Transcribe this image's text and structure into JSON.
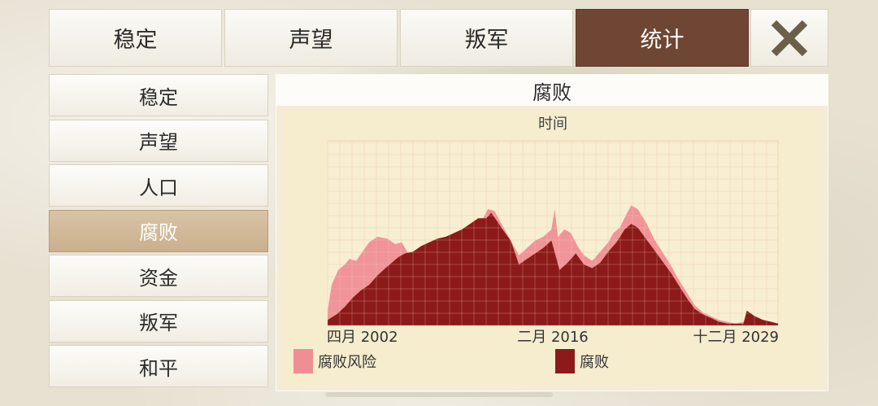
{
  "tabs": [
    {
      "label": "稳定",
      "active": false
    },
    {
      "label": "声望",
      "active": false
    },
    {
      "label": "叛军",
      "active": false
    },
    {
      "label": "统计",
      "active": true
    }
  ],
  "close_icon": "close-x-icon",
  "sidebar": {
    "items": [
      {
        "label": "稳定",
        "active": false
      },
      {
        "label": "声望",
        "active": false
      },
      {
        "label": "人口",
        "active": false
      },
      {
        "label": "腐败",
        "active": true
      },
      {
        "label": "资金",
        "active": false
      },
      {
        "label": "叛军",
        "active": false
      },
      {
        "label": "和平",
        "active": false
      }
    ]
  },
  "panel": {
    "title": "腐败"
  },
  "colors": {
    "active_tab": "#6f4533",
    "active_side": "#c9b08d",
    "risk": "#ef8e93",
    "corruption": "#8c1a1a",
    "chart_bg": "#f6ecce"
  },
  "chart_data": {
    "type": "area",
    "title": "时间",
    "x_labels": [
      "四月 2002",
      "二月 2016",
      "十二月 2029"
    ],
    "x_range": [
      2002.25,
      2029.92
    ],
    "ylim": [
      0,
      100
    ],
    "grid": true,
    "legend_position": "bottom-left",
    "series": [
      {
        "name": "腐败风险",
        "color": "#ef8e93",
        "points": [
          [
            2002.25,
            8
          ],
          [
            2002.5,
            22
          ],
          [
            2002.9,
            30
          ],
          [
            2003.3,
            33
          ],
          [
            2003.6,
            36
          ],
          [
            2004.0,
            35
          ],
          [
            2004.4,
            40
          ],
          [
            2004.8,
            45
          ],
          [
            2005.3,
            48
          ],
          [
            2005.9,
            47
          ],
          [
            2006.4,
            44
          ],
          [
            2006.8,
            45
          ],
          [
            2007.2,
            39
          ],
          [
            2007.6,
            37
          ],
          [
            2008.0,
            35
          ],
          [
            2008.5,
            37
          ],
          [
            2009.0,
            38
          ],
          [
            2009.5,
            40
          ],
          [
            2010.0,
            43
          ],
          [
            2010.5,
            46
          ],
          [
            2011.0,
            48
          ],
          [
            2011.4,
            51
          ],
          [
            2011.8,
            58
          ],
          [
            2012.1,
            63
          ],
          [
            2012.5,
            62
          ],
          [
            2013.0,
            54
          ],
          [
            2013.5,
            46
          ],
          [
            2014.0,
            38
          ],
          [
            2014.5,
            42
          ],
          [
            2015.0,
            46
          ],
          [
            2015.5,
            48
          ],
          [
            2016.0,
            52
          ],
          [
            2016.2,
            63
          ],
          [
            2016.4,
            48
          ],
          [
            2016.8,
            52
          ],
          [
            2017.2,
            50
          ],
          [
            2017.6,
            43
          ],
          [
            2018.0,
            38
          ],
          [
            2018.5,
            35
          ],
          [
            2019.0,
            40
          ],
          [
            2019.5,
            45
          ],
          [
            2019.8,
            50
          ],
          [
            2020.2,
            53
          ],
          [
            2020.6,
            60
          ],
          [
            2020.9,
            65
          ],
          [
            2021.3,
            63
          ],
          [
            2021.8,
            56
          ],
          [
            2022.3,
            47
          ],
          [
            2022.8,
            40
          ],
          [
            2023.3,
            33
          ],
          [
            2023.8,
            25
          ],
          [
            2024.3,
            18
          ],
          [
            2024.8,
            11
          ],
          [
            2025.3,
            7
          ],
          [
            2025.8,
            5
          ],
          [
            2026.3,
            3
          ],
          [
            2026.8,
            2
          ],
          [
            2027.3,
            1
          ],
          [
            2027.8,
            2
          ],
          [
            2028.0,
            7
          ],
          [
            2028.5,
            5
          ],
          [
            2029.0,
            3
          ],
          [
            2029.5,
            2
          ],
          [
            2029.92,
            1
          ]
        ]
      },
      {
        "name": "腐败",
        "color": "#8c1a1a",
        "points": [
          [
            2002.25,
            3
          ],
          [
            2002.8,
            6
          ],
          [
            2003.3,
            10
          ],
          [
            2003.8,
            15
          ],
          [
            2004.3,
            19
          ],
          [
            2004.8,
            22
          ],
          [
            2005.3,
            27
          ],
          [
            2005.8,
            31
          ],
          [
            2006.2,
            34
          ],
          [
            2006.6,
            37
          ],
          [
            2007.0,
            39
          ],
          [
            2007.5,
            40
          ],
          [
            2008.0,
            43
          ],
          [
            2008.5,
            45
          ],
          [
            2009.0,
            47
          ],
          [
            2009.5,
            48
          ],
          [
            2010.0,
            50
          ],
          [
            2010.5,
            52
          ],
          [
            2011.0,
            55
          ],
          [
            2011.5,
            58
          ],
          [
            2012.0,
            58
          ],
          [
            2012.3,
            61
          ],
          [
            2012.7,
            56
          ],
          [
            2013.0,
            52
          ],
          [
            2013.5,
            46
          ],
          [
            2014.0,
            33
          ],
          [
            2014.5,
            36
          ],
          [
            2015.0,
            39
          ],
          [
            2015.5,
            42
          ],
          [
            2016.0,
            46
          ],
          [
            2016.5,
            30
          ],
          [
            2017.0,
            34
          ],
          [
            2017.5,
            39
          ],
          [
            2018.0,
            33
          ],
          [
            2018.5,
            31
          ],
          [
            2019.0,
            34
          ],
          [
            2019.5,
            40
          ],
          [
            2020.0,
            45
          ],
          [
            2020.5,
            52
          ],
          [
            2020.9,
            55
          ],
          [
            2021.3,
            53
          ],
          [
            2021.8,
            47
          ],
          [
            2022.3,
            41
          ],
          [
            2022.8,
            35
          ],
          [
            2023.3,
            29
          ],
          [
            2023.8,
            22
          ],
          [
            2024.3,
            15
          ],
          [
            2024.8,
            9
          ],
          [
            2025.3,
            6
          ],
          [
            2025.8,
            4
          ],
          [
            2026.3,
            2
          ],
          [
            2026.8,
            1
          ],
          [
            2027.3,
            1
          ],
          [
            2027.8,
            1
          ],
          [
            2028.0,
            8
          ],
          [
            2028.5,
            5
          ],
          [
            2029.0,
            3
          ],
          [
            2029.5,
            2
          ],
          [
            2029.92,
            1
          ]
        ]
      }
    ]
  }
}
